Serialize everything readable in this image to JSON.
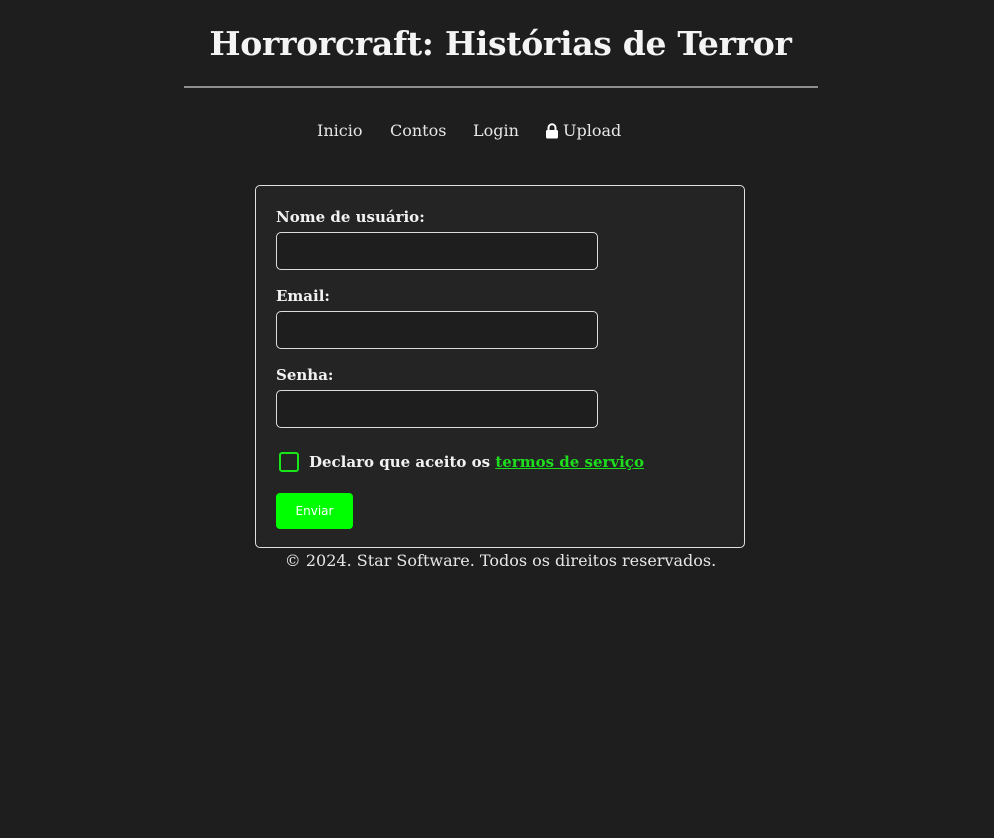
{
  "header": {
    "title": "Horrorcraft: Histórias de Terror"
  },
  "nav": {
    "items": [
      {
        "label": "Inicio"
      },
      {
        "label": "Contos"
      },
      {
        "label": "Login"
      },
      {
        "label": "Upload",
        "icon": "lock-icon"
      }
    ]
  },
  "form": {
    "username_label": "Nome de usuário:",
    "username_value": "",
    "email_label": "Email:",
    "email_value": "",
    "password_label": "Senha:",
    "password_value": "",
    "terms_text": "Declaro que aceito os",
    "terms_link": "termos de serviço",
    "terms_checked": false,
    "submit_label": "Enviar"
  },
  "footer": {
    "text": "© 2024. Star Software. Todos os direitos reservados."
  },
  "colors": {
    "background": "#1e1e1e",
    "card_background": "#242424",
    "accent_green": "#00ff00",
    "link_green": "#1edc1e",
    "text": "#f2f2f2"
  }
}
